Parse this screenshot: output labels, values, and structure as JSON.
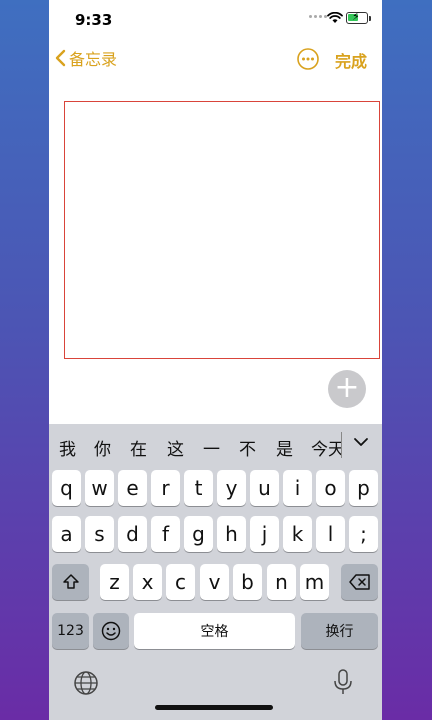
{
  "status_bar": {
    "time": "9:33"
  },
  "nav": {
    "back_label": "备忘录",
    "done_label": "完成"
  },
  "candidates": [
    "我",
    "你",
    "在",
    "这",
    "一",
    "不",
    "是",
    "今天"
  ],
  "keys": {
    "row1": [
      "q",
      "w",
      "e",
      "r",
      "t",
      "y",
      "u",
      "i",
      "o",
      "p"
    ],
    "row2": [
      "a",
      "s",
      "d",
      "f",
      "g",
      "h",
      "j",
      "k",
      "l",
      ";"
    ],
    "row3": [
      "z",
      "x",
      "c",
      "v",
      "b",
      "n",
      "m"
    ],
    "numbers": "123",
    "space": "空格",
    "return": "换行"
  },
  "colors": {
    "accent": "#d9a21e",
    "canvas_border": "#d9443a",
    "battery": "#34c759"
  },
  "icons": {
    "back": "chevron-left-icon",
    "more": "ellipsis-circle-icon",
    "add": "plus-icon",
    "shift": "shift-icon",
    "delete": "delete-icon",
    "emoji": "emoji-icon",
    "globe": "globe-icon",
    "mic": "microphone-icon",
    "collapse": "chevron-down-icon"
  }
}
